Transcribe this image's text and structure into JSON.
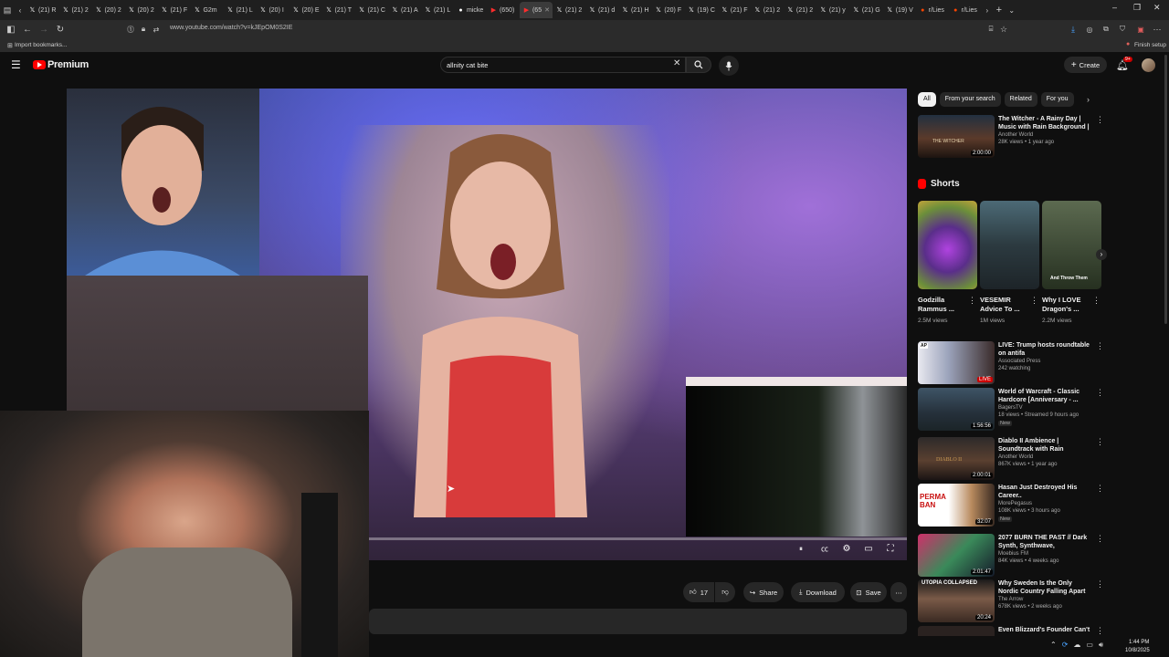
{
  "browser": {
    "tabs": [
      {
        "label": "(21) R",
        "icon": "x-logo"
      },
      {
        "label": "(21) 2",
        "icon": "x-logo"
      },
      {
        "label": "(20) 2",
        "icon": "x-logo"
      },
      {
        "label": "(20) 2",
        "icon": "x-logo"
      },
      {
        "label": "(21) F",
        "icon": "x-logo"
      },
      {
        "label": "G2m",
        "icon": "x-logo"
      },
      {
        "label": "(21) L",
        "icon": "x-logo"
      },
      {
        "label": "(20) I",
        "icon": "x-logo"
      },
      {
        "label": "(20) E",
        "icon": "x-logo"
      },
      {
        "label": "(21) T",
        "icon": "x-logo"
      },
      {
        "label": "(21) C",
        "icon": "x-logo"
      },
      {
        "label": "(21) A",
        "icon": "x-logo"
      },
      {
        "label": "(21) L",
        "icon": "x-logo"
      },
      {
        "label": "micke",
        "icon": "github-logo"
      },
      {
        "label": "(650)",
        "icon": "youtube-logo"
      },
      {
        "label": "(65",
        "icon": "youtube-logo",
        "active": true
      },
      {
        "label": "(21) 2",
        "icon": "x-logo"
      },
      {
        "label": "(21) d",
        "icon": "x-logo"
      },
      {
        "label": "(21) H",
        "icon": "x-logo"
      },
      {
        "label": "(20) F",
        "icon": "x-logo"
      },
      {
        "label": "(19) C",
        "icon": "x-logo"
      },
      {
        "label": "(21) F",
        "icon": "x-logo"
      },
      {
        "label": "(21) 2",
        "icon": "x-logo"
      },
      {
        "label": "(21) 2",
        "icon": "x-logo"
      },
      {
        "label": "(21) y",
        "icon": "x-logo"
      },
      {
        "label": "(21) G",
        "icon": "x-logo"
      },
      {
        "label": "(19) V",
        "icon": "x-logo"
      },
      {
        "label": "r/Lies",
        "icon": "reddit-logo"
      },
      {
        "label": "r/Lies",
        "icon": "reddit-logo"
      }
    ],
    "new_tab": "+",
    "url": "www.youtube.com/watch?v=kJEpOM0S2IE",
    "bookmarks_import": "Import bookmarks...",
    "finish_setup": "Finish setup"
  },
  "youtube": {
    "brand": "Premium",
    "search_query": "allnity cat bite",
    "create_label": "Create",
    "notifications_badge": "9+",
    "progress_fraction": 0.0
  },
  "actions": {
    "likes": "17",
    "share": "Share",
    "download": "Download",
    "save": "Save"
  },
  "sidebar": {
    "chips": [
      "All",
      "From your search",
      "Related",
      "For you"
    ],
    "top_video": {
      "title": "The Witcher - A Rainy Day | Music with Rain Background | ...",
      "channel": "Another World",
      "meta": "28K views • 1 year ago",
      "duration": "2:00:00",
      "thumb_text": "THE WITCHER"
    },
    "shorts_heading": "Shorts",
    "shorts": [
      {
        "title": "Godzilla Rammus ...",
        "views": "2.5M views"
      },
      {
        "title": "VESEMIR Advice To ...",
        "views": "1M views"
      },
      {
        "title": "Why I LOVE Dragon's ...",
        "views": "2.2M views",
        "overlay": "And Throw Them"
      }
    ],
    "videos": [
      {
        "title": "LIVE: Trump hosts roundtable on antifa",
        "channel": "Associated Press",
        "meta": "242 watching",
        "badge_live": "LIVE",
        "thumb_text": "AP"
      },
      {
        "title": "World of Warcraft - Classic Hardcore [Anniversary - ...",
        "channel": "BagersTV",
        "meta": "18 views • Streamed 9 hours ago",
        "new": "New",
        "duration": "1:56:56"
      },
      {
        "title": "Diablo II Ambience | Soundtrack with Rain Background | Relax i...",
        "channel": "Another World",
        "meta": "867K views • 1 year ago",
        "duration": "2:00:01",
        "thumb_text": "DIABLO II"
      },
      {
        "title": "Hasan Just Destroyed His Career..",
        "channel": "MorePegasus",
        "meta": "108K views • 3 hours ago",
        "new": "New",
        "duration": "32:07",
        "thumb_text": "PERMA BAN"
      },
      {
        "title": "2077 BURN THE PAST // Dark Synth, Synthwave, Vaporwave,...",
        "channel": "Moebius FM",
        "meta": "84K views • 4 weeks ago",
        "duration": "2:01:47"
      },
      {
        "title": "Why Sweden Is the Only Nordic Country Falling Apart",
        "channel": "The Arrow",
        "meta": "678K views • 2 weeks ago",
        "duration": "20:24",
        "thumb_text": "UTOPIA COLLAPSED"
      },
      {
        "title": "Even Blizzard's Founder Can't",
        "channel": "",
        "meta": ""
      }
    ]
  },
  "taskbar": {
    "time": "1:44 PM",
    "date": "10/8/2025"
  },
  "colors": {
    "accent": "#ff0000",
    "background": "#0f0f0f",
    "chip_bg": "#272727"
  }
}
